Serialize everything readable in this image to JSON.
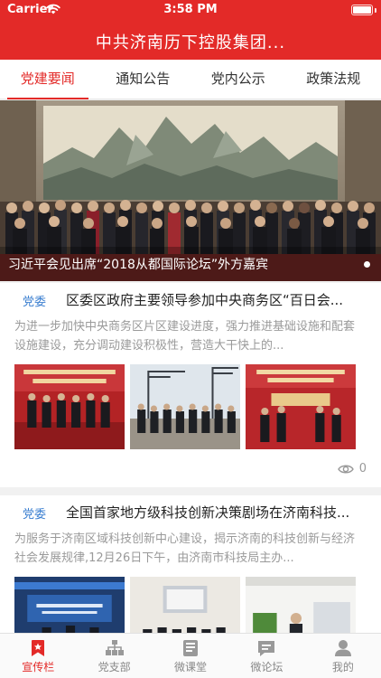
{
  "status_bar": {
    "carrier": "Carrier",
    "time": "3:58 PM",
    "icons": [
      "wifi-icon",
      "battery-icon"
    ]
  },
  "header": {
    "title": "中共济南历下控股集团..."
  },
  "tabs": [
    {
      "label": "党建要闻",
      "active": true
    },
    {
      "label": "通知公告",
      "active": false
    },
    {
      "label": "党内公示",
      "active": false
    },
    {
      "label": "政策法规",
      "active": false
    }
  ],
  "banner": {
    "caption": "习近平会见出席“2018从都国际论坛”外方嘉宾"
  },
  "news": [
    {
      "tag": "党委",
      "title": "区委区政府主要领导参加中央商务区“百日会...",
      "summary": "为进一步加快中央商务区片区建设进度，强力推进基础设施和配套设施建设，充分调动建设积极性，营造大干快上的...",
      "views": "0",
      "thumbnail_count": 3
    },
    {
      "tag": "党委",
      "title": "全国首家地方级科技创新决策剧场在济南科技...",
      "summary": "为服务于济南区域科技创新中心建设，揭示济南的科技创新与经济社会发展规律,12月26日下午，由济南市科技局主办...",
      "thumbnail_count": 3
    }
  ],
  "bottom_nav": [
    {
      "label": "宣传栏",
      "icon": "bookmark-icon",
      "active": true
    },
    {
      "label": "党支部",
      "icon": "org-chart-icon",
      "active": false
    },
    {
      "label": "微课堂",
      "icon": "book-icon",
      "active": false
    },
    {
      "label": "微论坛",
      "icon": "chat-icon",
      "active": false
    },
    {
      "label": "我的",
      "icon": "user-icon",
      "active": false
    }
  ],
  "colors": {
    "brand_red": "#e32a28",
    "tag_blue": "#3b7fd0",
    "muted_text": "#9a9a9a"
  }
}
